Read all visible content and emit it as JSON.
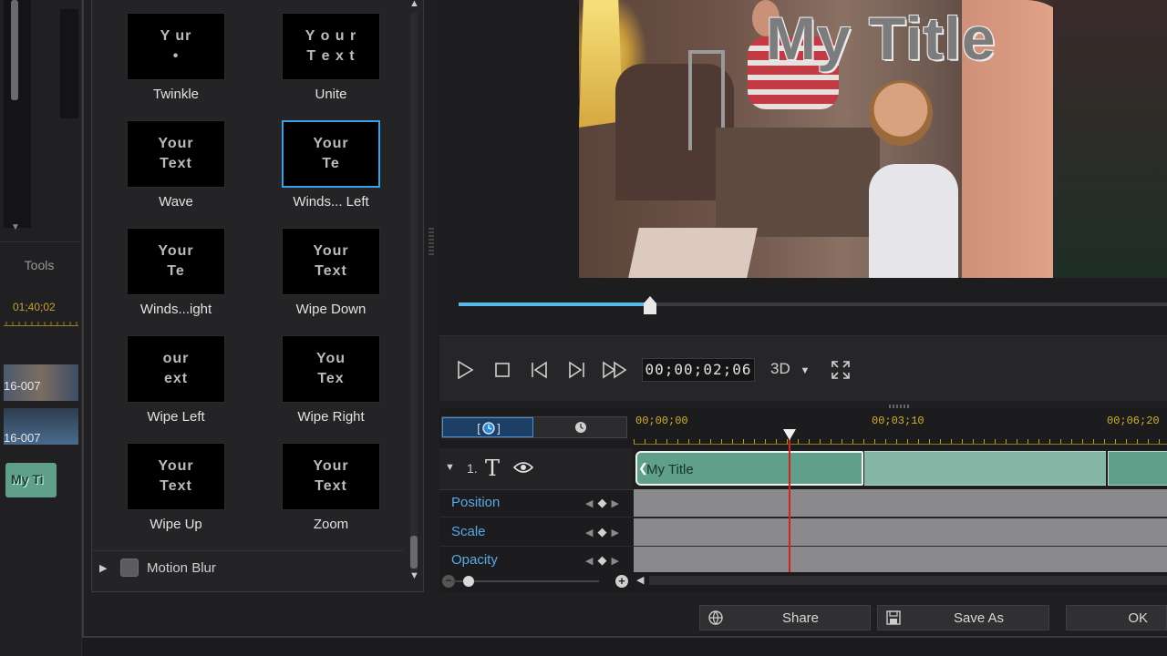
{
  "background_app": {
    "tools_label": "Tools",
    "time_label": "01;40;02",
    "clip_labels": [
      "16-007",
      "16-007"
    ],
    "title_clip_label": "My Ti"
  },
  "effects": [
    {
      "thumb": [
        "Y  ur",
        "•"
      ],
      "label": "Twinkle",
      "icon": "twinkle-preview"
    },
    {
      "thumb": [
        "Y o u r",
        "T e x t"
      ],
      "label": "Unite",
      "icon": "unite-preview"
    },
    {
      "thumb": [
        "Your",
        "Text"
      ],
      "label": "Wave",
      "icon": "wave-preview"
    },
    {
      "thumb": [
        "Your",
        "Te"
      ],
      "label": "Winds... Left",
      "icon": "winds-left-preview",
      "selected": true
    },
    {
      "thumb": [
        "Your",
        "Te"
      ],
      "label": "Winds...ight",
      "icon": "winds-right-preview"
    },
    {
      "thumb": [
        "Your",
        "Text"
      ],
      "label": "Wipe Down",
      "icon": "wipe-down-preview"
    },
    {
      "thumb": [
        "our",
        "ext"
      ],
      "label": "Wipe Left",
      "icon": "wipe-left-preview"
    },
    {
      "thumb": [
        "You",
        "Tex"
      ],
      "label": "Wipe Right",
      "icon": "wipe-right-preview"
    },
    {
      "thumb": [
        "Your",
        "Text"
      ],
      "label": "Wipe Up",
      "icon": "wipe-up-preview"
    },
    {
      "thumb": [
        "Your",
        "Text"
      ],
      "label": "Zoom",
      "icon": "zoom-preview"
    }
  ],
  "motion_blur": {
    "label": "Motion Blur",
    "checked": false
  },
  "preview": {
    "title_text": "My Title",
    "seek_progress": 0.27
  },
  "player": {
    "timecode": "00;00;02;06",
    "mode": "3D"
  },
  "timeline": {
    "ruler_times": [
      "00;00;00",
      "00;03;10",
      "00;06;20"
    ],
    "track_number": "1.",
    "clip_label": "My Title",
    "keyframe_rows": [
      "Position",
      "Scale",
      "Opacity"
    ]
  },
  "buttons": {
    "share": "Share",
    "save_as": "Save As",
    "ok": "OK"
  },
  "colors": {
    "accent": "#3aa2ea",
    "keyframe_label": "#5aa8e4",
    "clip": "#609f8a",
    "ruler_time": "#d4b02c",
    "playhead": "#d92020"
  }
}
